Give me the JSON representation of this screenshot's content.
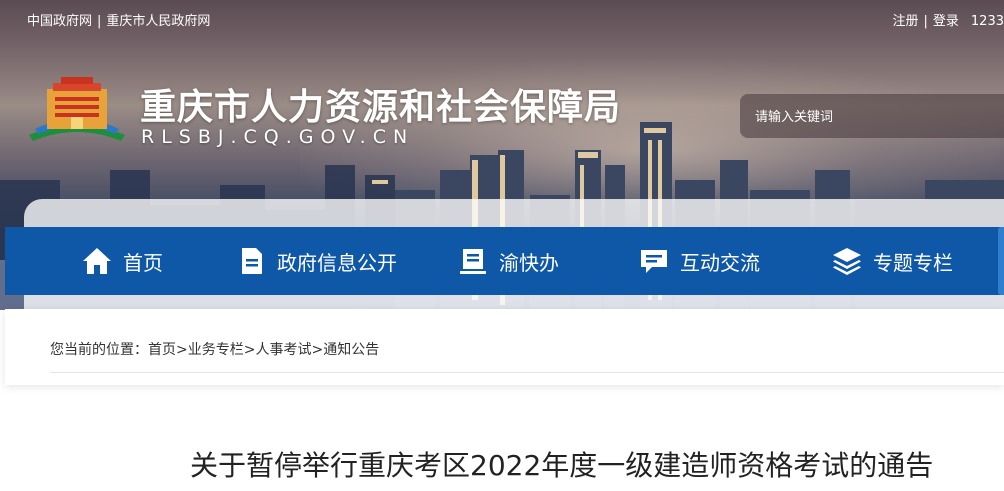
{
  "topbar": {
    "links_left": [
      "中国政府网",
      "重庆市人民政府网"
    ],
    "separator": "|",
    "register": "注册",
    "login": "登录",
    "hotline": "1233"
  },
  "header": {
    "title": "重庆市人力资源和社会保障局",
    "domain": "RLSBJ.CQ.GOV.CN"
  },
  "search": {
    "placeholder": "请输入关键词"
  },
  "nav": {
    "items": [
      {
        "label": "首页",
        "icon": "home-icon"
      },
      {
        "label": "政府信息公开",
        "icon": "document-icon"
      },
      {
        "label": "渝快办",
        "icon": "service-icon"
      },
      {
        "label": "互动交流",
        "icon": "chat-icon"
      },
      {
        "label": "专题专栏",
        "icon": "layers-icon"
      }
    ]
  },
  "breadcrumb": {
    "prefix": "您当前的位置：",
    "items": [
      "首页",
      "业务专栏",
      "人事考试",
      "通知公告"
    ],
    "separator": ">"
  },
  "article": {
    "title": "关于暂停举行重庆考区2022年度一级建造师资格考试的通告"
  },
  "colors": {
    "nav_bg": "#0f58a8",
    "text_dark": "#222222"
  }
}
